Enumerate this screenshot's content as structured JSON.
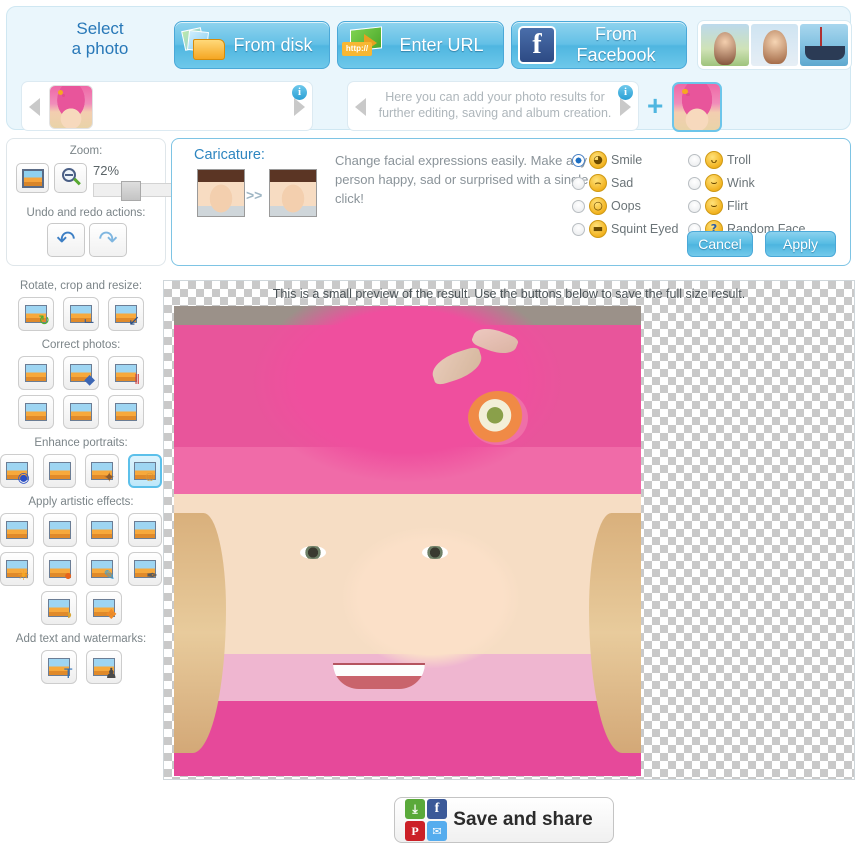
{
  "top": {
    "select_label_line1": "Select",
    "select_label_line2": "a photo",
    "buttons": [
      {
        "id": "from-disk",
        "label": "From disk",
        "icon": "folder-photos-icon"
      },
      {
        "id": "enter-url",
        "label": "Enter URL",
        "icon": "http-arrow-icon"
      },
      {
        "id": "from-facebook",
        "label": "From Facebook",
        "icon": "facebook-icon"
      }
    ],
    "samples_alt": [
      "woman-sample",
      "man-sample",
      "boat-sample"
    ],
    "source_strip": {
      "hint": "",
      "info": "i"
    },
    "result_strip": {
      "hint": "Here you can add your photo results for further editing, saving and album creation.",
      "info": "i"
    },
    "plus": "+"
  },
  "zoom_panel": {
    "zoom_caption": "Zoom:",
    "zoom_value": "72%",
    "fit_icon": "fit-to-screen-icon",
    "zoom_out_icon": "zoom-out-icon",
    "undo_caption": "Undo and redo actions:",
    "undo_icon": "undo-arrow-icon",
    "redo_icon": "redo-arrow-icon"
  },
  "caricature": {
    "title": "Caricature:",
    "description": "Change facial expressions easily. Make any person happy, sad or surprised with a single click!",
    "before_alt": "before-face-thumbnail",
    "after_alt": "after-face-thumbnail",
    "arrow": ">>",
    "options": [
      {
        "label": "Smile",
        "glyph": "◕",
        "selected": true
      },
      {
        "label": "Troll",
        "glyph": "ᴗ",
        "selected": false
      },
      {
        "label": "Sad",
        "glyph": "⌢",
        "selected": false
      },
      {
        "label": "Wink",
        "glyph": "⌣",
        "selected": false
      },
      {
        "label": "Oops",
        "glyph": "○",
        "selected": false
      },
      {
        "label": "Flirt",
        "glyph": "⌣",
        "selected": false
      },
      {
        "label": "Squint Eyed",
        "glyph": "▬",
        "selected": false
      },
      {
        "label": "Random Face",
        "glyph": "?",
        "selected": false
      }
    ],
    "cancel_label": "Cancel",
    "apply_label": "Apply"
  },
  "sidebar": {
    "groups": [
      {
        "caption": "Rotate, crop and resize:",
        "rows": [
          [
            {
              "name": "rotate-tool",
              "badge": "↻",
              "badge_color": "#4caf2f",
              "selected": false
            },
            {
              "name": "crop-tool",
              "badge": "⌙",
              "badge_color": "#3f5f8f",
              "selected": false
            },
            {
              "name": "resize-tool",
              "badge": "↙",
              "badge_color": "#2a4f86",
              "selected": false
            }
          ]
        ]
      },
      {
        "caption": "Correct photos:",
        "rows": [
          [
            {
              "name": "color-correct-tool",
              "badge": "",
              "badge_color": "#d04aa0",
              "selected": false
            },
            {
              "name": "perspective-tool",
              "badge": "◆",
              "badge_color": "#3c66b4",
              "selected": false
            },
            {
              "name": "temperature-tool",
              "badge": "‖",
              "badge_color": "#d23c3c",
              "selected": false
            }
          ],
          [
            {
              "name": "saturation-tool",
              "badge": "",
              "badge_color": "#e0607a",
              "selected": false
            },
            {
              "name": "sharpen-tool",
              "badge": "",
              "badge_color": "#8d8071",
              "selected": false
            },
            {
              "name": "noise-remove-tool",
              "badge": "",
              "badge_color": "#7d7d7d",
              "selected": false
            }
          ]
        ]
      },
      {
        "caption": "Enhance portraits:",
        "rows": [
          [
            {
              "name": "red-eye-tool",
              "badge": "◉",
              "badge_color": "#2b4fc4",
              "selected": false
            },
            {
              "name": "skin-retouch-tool",
              "badge": "",
              "badge_color": "#a9743f",
              "selected": false
            },
            {
              "name": "makeup-tool",
              "badge": "✦",
              "badge_color": "#8a5a2d",
              "selected": false
            },
            {
              "name": "caricature-tool",
              "badge": "☺",
              "badge_color": "#d79a3c",
              "selected": true
            }
          ]
        ]
      },
      {
        "caption": "Apply artistic effects:",
        "rows": [
          [
            {
              "name": "vignette-tool",
              "badge": "",
              "badge_color": "#6e6e6e",
              "selected": false
            },
            {
              "name": "sepia-tool",
              "badge": "",
              "badge_color": "#c9a477",
              "selected": false
            },
            {
              "name": "rainbow-tool",
              "badge": "",
              "badge_color": "#7dc83c",
              "selected": false
            },
            {
              "name": "night-effect-tool",
              "badge": "",
              "badge_color": "#21307a",
              "selected": false
            }
          ],
          [
            {
              "name": "sun-flare-tool",
              "badge": "☀",
              "badge_color": "#f5a623",
              "selected": false
            },
            {
              "name": "fire-tool",
              "badge": "●",
              "badge_color": "#e8641c",
              "selected": false
            },
            {
              "name": "pencil-tool",
              "badge": "✎",
              "badge_color": "#3aa0d8",
              "selected": false
            },
            {
              "name": "charcoal-tool",
              "badge": "✒",
              "badge_color": "#5a5a5a",
              "selected": false
            }
          ],
          [
            {
              "name": "paint-tool",
              "badge": "◑",
              "badge_color": "#d8a534",
              "selected": false
            },
            {
              "name": "mosaic-tool",
              "badge": "❖",
              "badge_color": "#f08c2a",
              "selected": false
            }
          ]
        ]
      },
      {
        "caption": "Add text and watermarks:",
        "rows": [
          [
            {
              "name": "add-text-tool",
              "badge": "T",
              "badge_color": "#2b6fb8",
              "selected": false
            },
            {
              "name": "watermark-tool",
              "badge": "♟",
              "badge_color": "#4a4a4a",
              "selected": false
            }
          ]
        ]
      }
    ]
  },
  "preview": {
    "note": "This is a small preview of the result. Use the buttons below to save the full size result.",
    "image_alt": "girl-in-pink-hat-preview"
  },
  "save": {
    "label": "Save and share",
    "icons": [
      {
        "name": "download-icon",
        "glyph": "⤓"
      },
      {
        "name": "facebook-icon",
        "glyph": "f"
      },
      {
        "name": "pinterest-icon",
        "glyph": "P"
      },
      {
        "name": "twitter-icon",
        "glyph": "✉"
      }
    ]
  },
  "colors": {
    "accent_blue": "#4fb6e0",
    "panel_blue": "#eaf6fc",
    "title_blue": "#2878b8",
    "muted_text": "#7b8488"
  }
}
